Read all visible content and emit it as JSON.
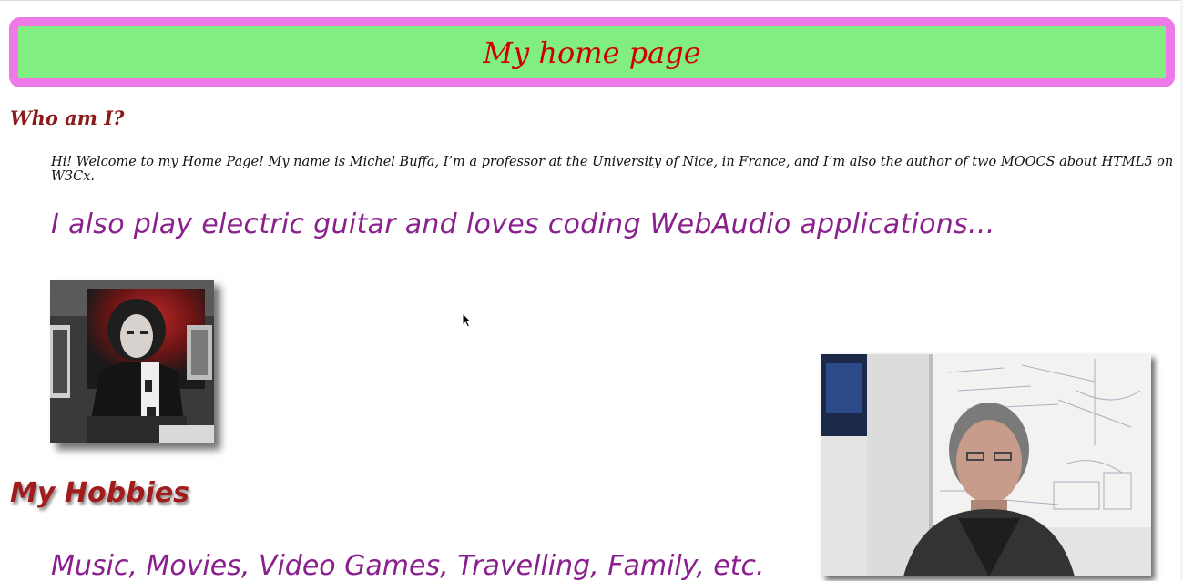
{
  "header": {
    "title": "My home page",
    "background_color": "#80ee82",
    "border_color": "#ee7ae7",
    "title_color": "#d10000"
  },
  "about": {
    "heading": "Who am I?",
    "intro": "Hi! Welcome to my Home Page! My name is Michel Buffa, I’m a professor at the University of Nice, in France, and I’m also the author of two MOOCS about HTML5 on W3Cx.",
    "guitar_line": "I also play electric guitar and loves coding WebAudio applications..."
  },
  "photo": {
    "icon": "guitarist-photo"
  },
  "hobbies": {
    "heading": "My Hobbies",
    "list": "Music, Movies, Video Games, Travelling, Family, etc."
  },
  "webcam": {
    "icon": "presenter-webcam-video"
  },
  "colors": {
    "heading_red": "#8b1a1a",
    "accent_purple": "#8a1f8e",
    "hobbies_red": "#a11c1c"
  }
}
